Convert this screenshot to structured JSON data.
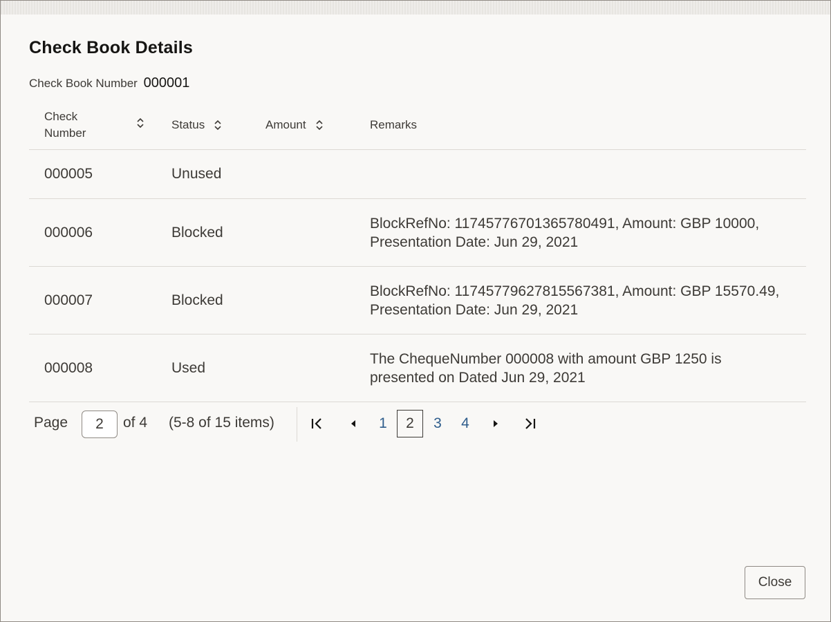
{
  "dialog": {
    "title": "Check Book Details",
    "check_book_label": "Check Book Number",
    "check_book_value": "000001"
  },
  "table": {
    "columns": [
      {
        "label": "Check Number",
        "label_line1": "Check",
        "label_line2": "Number",
        "sortable": true
      },
      {
        "label": "Status",
        "sortable": true
      },
      {
        "label": "Amount",
        "sortable": true
      },
      {
        "label": "Remarks",
        "sortable": false
      }
    ],
    "rows": [
      {
        "check_number": "000005",
        "status": "Unused",
        "amount": "",
        "remarks_line1": "",
        "remarks_line2": ""
      },
      {
        "check_number": "000006",
        "status": "Blocked",
        "amount": "",
        "remarks_line1": "BlockRefNo: 117457767013657804​91, Amount: GBP 10000,",
        "remarks_line2": "Presentation Date: Jun 29, 2021"
      },
      {
        "check_number": "000007",
        "status": "Blocked",
        "amount": "",
        "remarks_line1": "BlockRefNo: 117457796278155673​81, Amount: GBP 15570.49,",
        "remarks_line2": "Presentation Date: Jun 29, 2021"
      },
      {
        "check_number": "000008",
        "status": "Used",
        "amount": "",
        "remarks_line1": "The ChequeNumber 000008 with amount GBP 1250 is",
        "remarks_line2": "presented on Dated Jun 29, 2021"
      }
    ]
  },
  "pagination": {
    "page_label": "Page",
    "current_page": "2",
    "of_label": "of 4",
    "range_label": "(5-8 of 15 items)",
    "pages": [
      "1",
      "2",
      "3",
      "4"
    ],
    "icons": {
      "first": "first-page-icon",
      "prev": "previous-page-icon",
      "next": "next-page-icon",
      "last": "last-page-icon"
    }
  },
  "footer": {
    "close_label": "Close"
  },
  "colors": {
    "background": "#f9f8f6",
    "text": "#3d3a36",
    "title": "#161513",
    "link": "#2f5d8c",
    "divider": "#dcd9d4"
  }
}
